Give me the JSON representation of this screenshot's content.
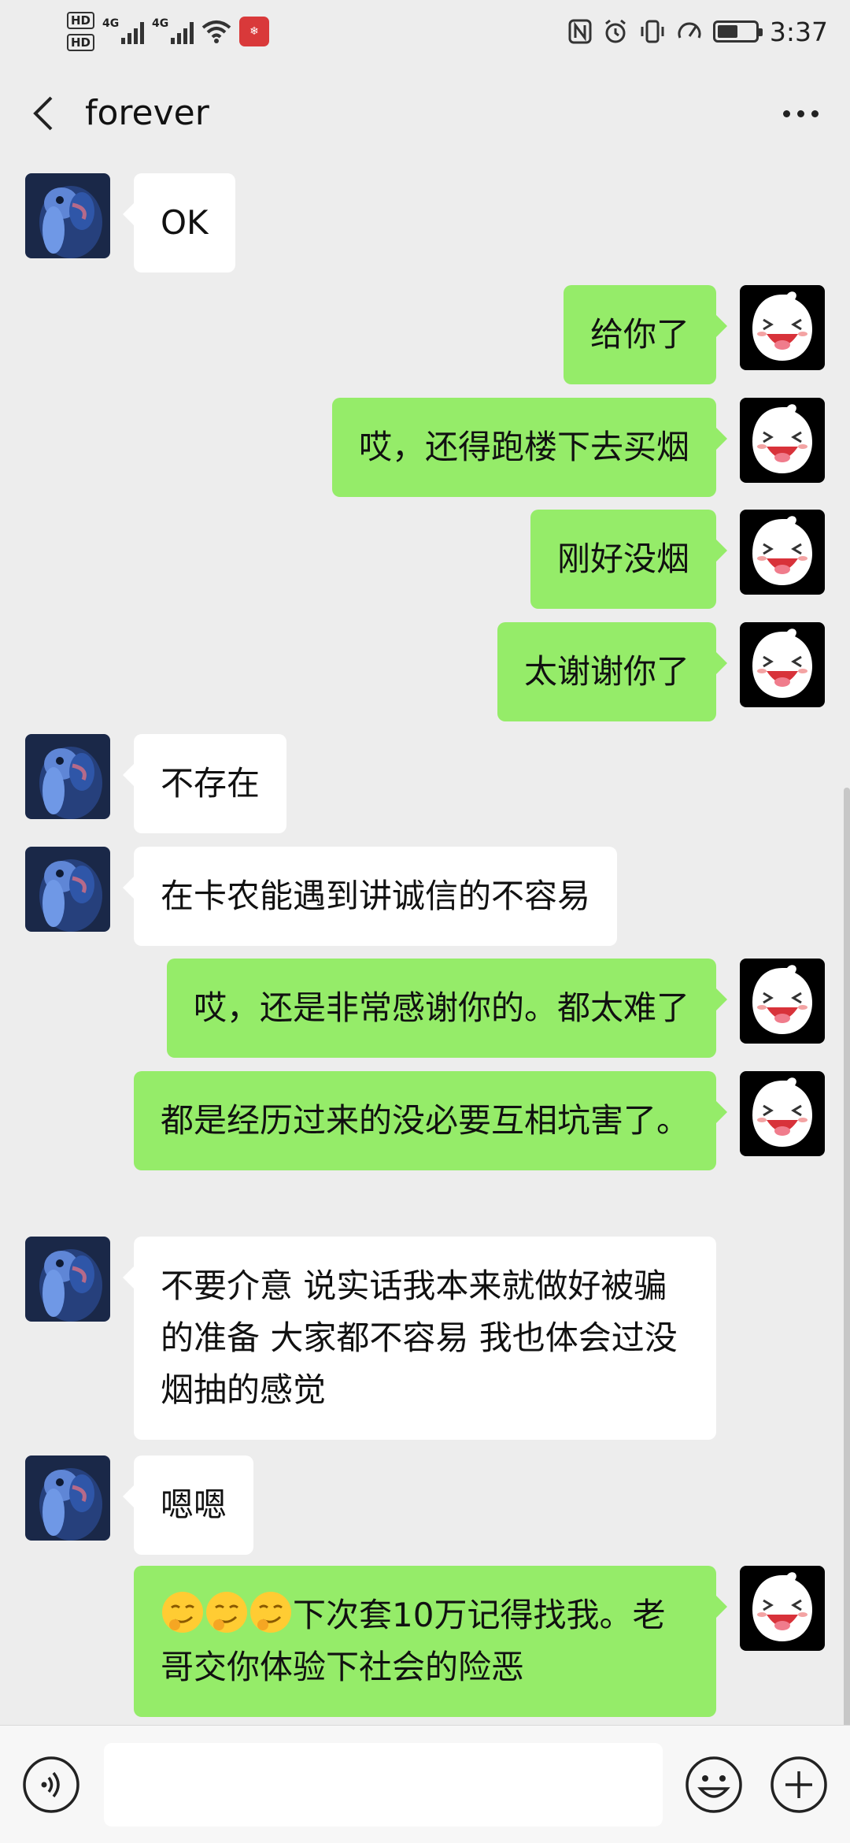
{
  "status_bar": {
    "hd1": "HD",
    "hd2": "HD",
    "net1": "4G",
    "net2": "4G",
    "time": "3:37",
    "battery_level": 0.55
  },
  "nav": {
    "title": "forever"
  },
  "messages": [
    {
      "side": "left",
      "text": "OK"
    },
    {
      "side": "right",
      "text": "给你了"
    },
    {
      "side": "right",
      "text": "哎，还得跑楼下去买烟"
    },
    {
      "side": "right",
      "text": "刚好没烟"
    },
    {
      "side": "right",
      "text": "太谢谢你了"
    },
    {
      "side": "left",
      "text": "不存在"
    },
    {
      "side": "left",
      "text": "在卡农能遇到讲诚信的不容易"
    },
    {
      "side": "right",
      "text": "哎，还是非常感谢你的。都太难了"
    },
    {
      "side": "right",
      "text": "都是经历过来的没必要互相坑害了。"
    },
    {
      "side": "left",
      "text": "不要介意  说实话我本来就做好被骗的准备  大家都不容易  我也体会过没烟抽的感觉"
    },
    {
      "side": "left",
      "text": "嗯嗯"
    },
    {
      "side": "right",
      "text": "下次套10万记得找我。老哥交你体验下社会的险恶",
      "emoji_prefix": [
        "smirk-emoji",
        "smirk-emoji",
        "smirk-emoji"
      ]
    }
  ],
  "input": {
    "value": "",
    "placeholder": ""
  },
  "icons": {
    "back": "chevron-left-icon",
    "more": "more-dots-icon",
    "voice": "voice-icon",
    "emoji": "emoji-icon",
    "plus": "plus-icon"
  },
  "colors": {
    "background": "#ededed",
    "sent_bubble": "#95ec69",
    "received_bubble": "#ffffff"
  }
}
